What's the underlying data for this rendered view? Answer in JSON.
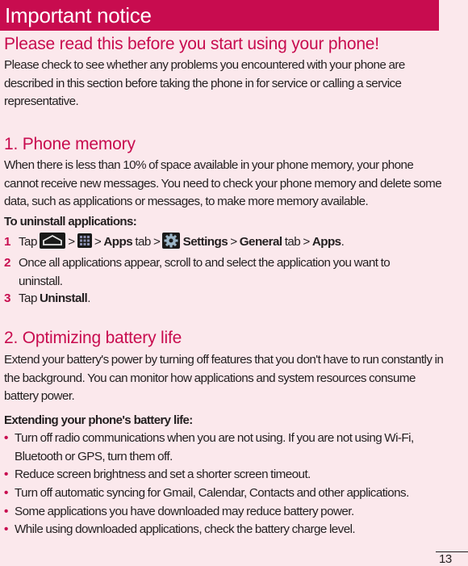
{
  "header": {
    "title": "Important notice"
  },
  "subtitle": "Please read this before you start using your phone!",
  "intro": "Please check to see whether any problems you encountered with your phone are described in this section before taking the phone in for service or calling a service representative.",
  "section1": {
    "heading": "1. Phone memory",
    "body": "When there is less than 10% of space available in your phone memory, your phone cannot receive new messages. You need to check your phone memory and delete some data, such as applications or messages, to make more memory available.",
    "label": "To uninstall applications:",
    "steps": [
      {
        "num": "1",
        "parts": {
          "tap": "Tap",
          "sep1": ">",
          "sep2": ">",
          "apps": "Apps",
          "tab1": "tab >",
          "settings": "Settings",
          "sep3": ">",
          "general": "General",
          "tab2": "tab >",
          "apps2": "Apps",
          "end": "."
        },
        "icons": [
          "home-icon",
          "apps-grid-icon",
          "settings-gear-icon"
        ]
      },
      {
        "num": "2",
        "text": "Once all applications appear, scroll to and select the application you want to uninstall."
      },
      {
        "num": "3",
        "tap": "Tap",
        "bold": "Uninstall",
        "end": "."
      }
    ]
  },
  "section2": {
    "heading": "2. Optimizing battery life",
    "body": "Extend your battery's power by turning off features that you don't have to run constantly in the background. You can monitor how applications and system resources consume battery power.",
    "label": "Extending your phone's battery life:",
    "bullets": [
      "Turn off radio communications when you are not using. If you are not using Wi-Fi, Bluetooth or GPS, turn them off.",
      "Reduce screen brightness and set a shorter screen timeout.",
      "Turn off automatic syncing for Gmail, Calendar, Contacts and other applications.",
      "Some applications you have downloaded may reduce battery power.",
      "While using downloaded applications, check the battery charge level."
    ]
  },
  "page_number": "13",
  "colors": {
    "accent": "#c80c4f",
    "background": "#fbe8ec",
    "text": "#231f20"
  }
}
